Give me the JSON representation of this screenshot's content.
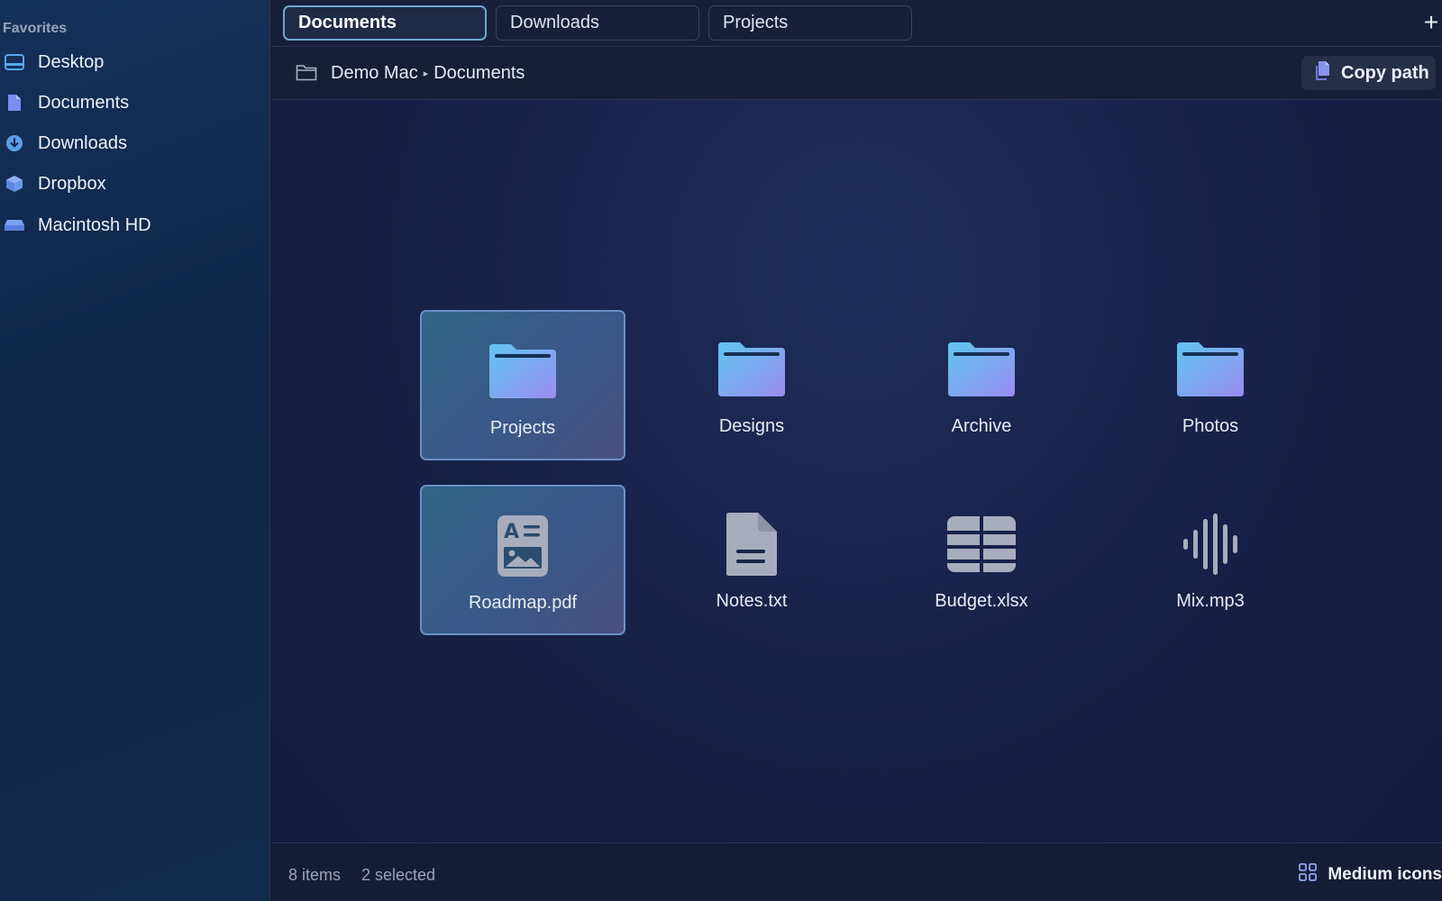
{
  "sidebar": {
    "heading": "Favorites",
    "items": [
      {
        "label": "Desktop",
        "icon": "desktop-icon"
      },
      {
        "label": "Documents",
        "icon": "document-icon"
      },
      {
        "label": "Downloads",
        "icon": "download-icon"
      },
      {
        "label": "Dropbox",
        "icon": "dropbox-icon"
      },
      {
        "label": "Macintosh HD",
        "icon": "hard-drive-icon"
      }
    ]
  },
  "tabs": [
    {
      "label": "Documents",
      "active": true
    },
    {
      "label": "Downloads",
      "active": false
    },
    {
      "label": "Projects",
      "active": false
    }
  ],
  "add_tab_label": "+",
  "path": {
    "device": "Demo Mac",
    "folder": "Documents",
    "separator": "▸",
    "copy_label": "Copy path"
  },
  "files": [
    {
      "label": "Projects",
      "type": "folder",
      "selected": true
    },
    {
      "label": "Designs",
      "type": "folder",
      "selected": false
    },
    {
      "label": "Archive",
      "type": "folder",
      "selected": false
    },
    {
      "label": "Photos",
      "type": "folder",
      "selected": false
    },
    {
      "label": "Roadmap.pdf",
      "type": "pdf",
      "selected": true
    },
    {
      "label": "Notes.txt",
      "type": "text",
      "selected": false
    },
    {
      "label": "Budget.xlsx",
      "type": "spreadsheet",
      "selected": false
    },
    {
      "label": "Mix.mp3",
      "type": "audio",
      "selected": false
    }
  ],
  "status": {
    "count": "8 items",
    "selected": "2 selected",
    "view_mode": "Medium icons"
  },
  "colors": {
    "accent": "#6fa6cf",
    "folder_top": "#5fc6f0",
    "folder_bottom": "#9a8cf0",
    "file_icon": "#a7adbd"
  }
}
